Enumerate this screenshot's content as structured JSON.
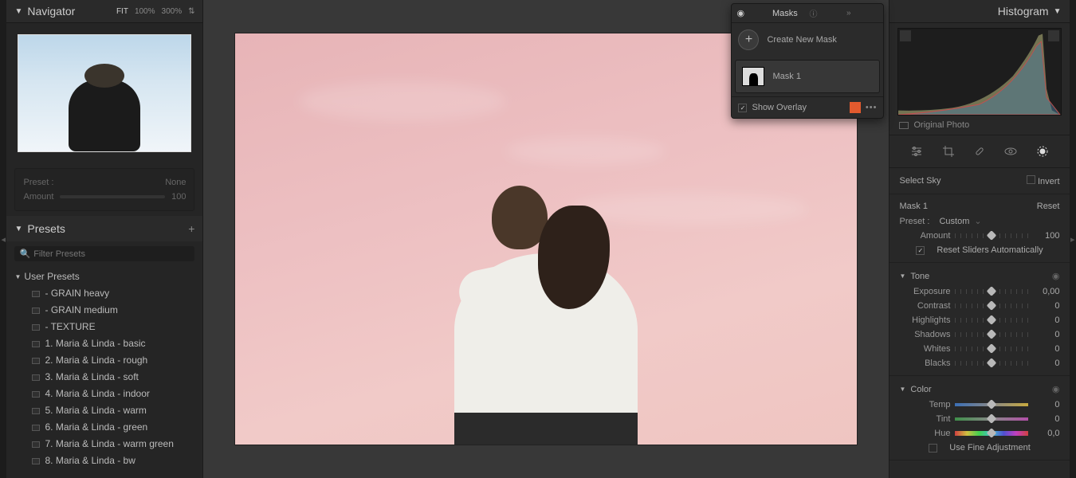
{
  "left": {
    "navigator": {
      "title": "Navigator",
      "fit": "FIT",
      "zoom1": "100%",
      "zoom2": "300%"
    },
    "preset_box": {
      "preset_label": "Preset :",
      "preset_value": "None",
      "amount_label": "Amount",
      "amount_value": "100"
    },
    "presets": {
      "title": "Presets",
      "filter_placeholder": "Filter Presets",
      "group": "User Presets",
      "items": [
        "- GRAIN heavy",
        "- GRAIN medium",
        "- TEXTURE",
        "1. Maria & Linda - basic",
        "2. Maria & Linda - rough",
        "3. Maria & Linda - soft",
        "4. Maria & Linda - indoor",
        "5. Maria & Linda - warm",
        "6. Maria & Linda - green",
        "7. Maria & Linda - warm green",
        "8. Maria & Linda - bw"
      ]
    }
  },
  "masks": {
    "title": "Masks",
    "create": "Create New Mask",
    "mask1": "Mask 1",
    "show_overlay": "Show Overlay",
    "overlay_color": "#e25a2e"
  },
  "right": {
    "histogram": "Histogram",
    "original": "Original Photo",
    "select_sky": "Select Sky",
    "invert": "Invert",
    "mask_label": "Mask 1",
    "reset": "Reset",
    "preset_label": "Preset :",
    "preset_value": "Custom",
    "amount_label": "Amount",
    "amount_value": "100",
    "reset_sliders": "Reset Sliders Automatically",
    "tone": {
      "title": "Tone",
      "exposure": {
        "label": "Exposure",
        "value": "0,00"
      },
      "contrast": {
        "label": "Contrast",
        "value": "0"
      },
      "highlights": {
        "label": "Highlights",
        "value": "0"
      },
      "shadows": {
        "label": "Shadows",
        "value": "0"
      },
      "whites": {
        "label": "Whites",
        "value": "0"
      },
      "blacks": {
        "label": "Blacks",
        "value": "0"
      }
    },
    "color": {
      "title": "Color",
      "temp": {
        "label": "Temp",
        "value": "0"
      },
      "tint": {
        "label": "Tint",
        "value": "0"
      },
      "hue": {
        "label": "Hue",
        "value": "0,0"
      },
      "fine": "Use Fine Adjustment"
    }
  }
}
